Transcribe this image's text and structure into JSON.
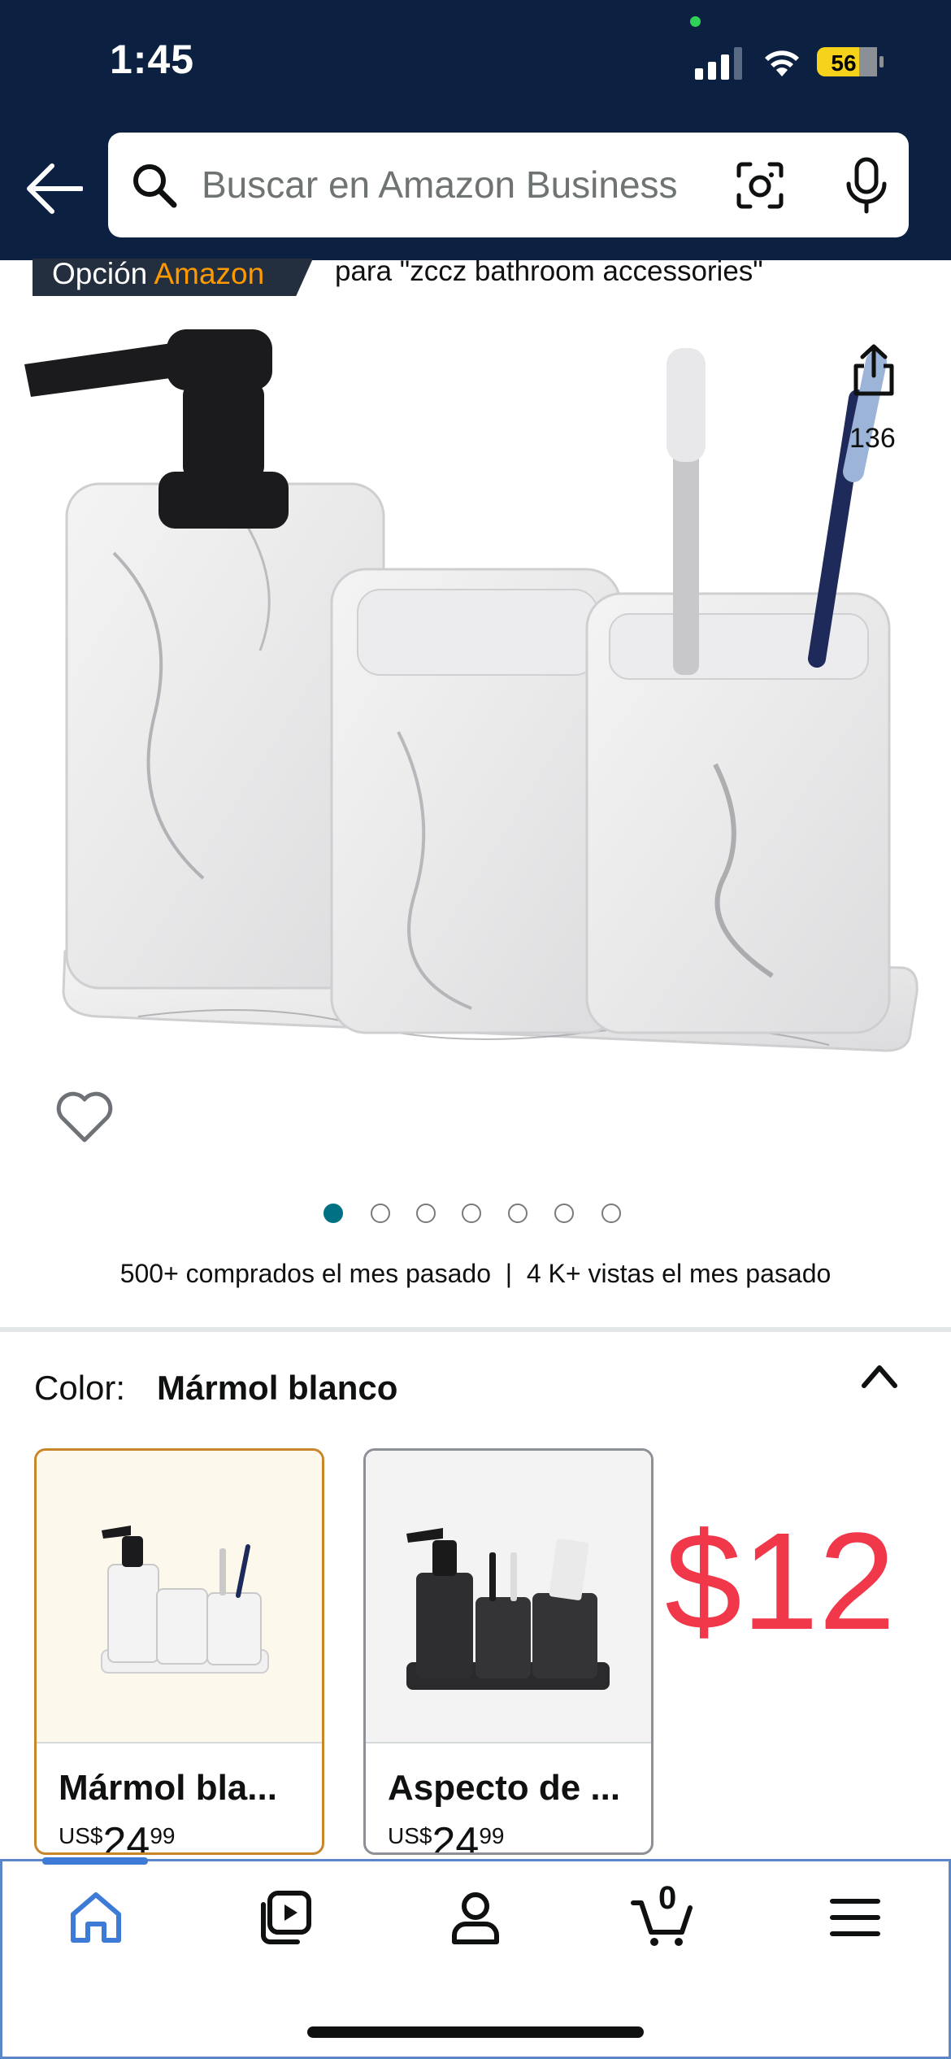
{
  "status_bar": {
    "time": "1:45",
    "battery_level": "56"
  },
  "search": {
    "placeholder": "Buscar en Amazon Business"
  },
  "badge": {
    "prefix": "Opción",
    "brand": "Amazon",
    "query": "para \"zccz bathroom accessories\""
  },
  "product": {
    "share_count": "136",
    "image_count": 7,
    "active_image_index": 0
  },
  "stats": {
    "purchased": "500+ comprados el mes pasado",
    "separator": "|",
    "views": "4 K+ vistas el mes pasado"
  },
  "color_selector": {
    "label": "Color:",
    "value": "Mármol blanco"
  },
  "variants": [
    {
      "title": "Mármol bla...",
      "currency": "US$",
      "whole": "24",
      "fraction": "99"
    },
    {
      "title": "Aspecto de ...",
      "currency": "US$",
      "whole": "24",
      "fraction": "99"
    }
  ],
  "price_overlay": "$12",
  "bottom_nav": {
    "cart_count": "0"
  },
  "colors": {
    "header_bg": "#0c2141",
    "badge_accent": "#ff9900",
    "dot_active": "#007185",
    "price_overlay": "#f0384a",
    "nav_active": "#3d7bd6"
  }
}
